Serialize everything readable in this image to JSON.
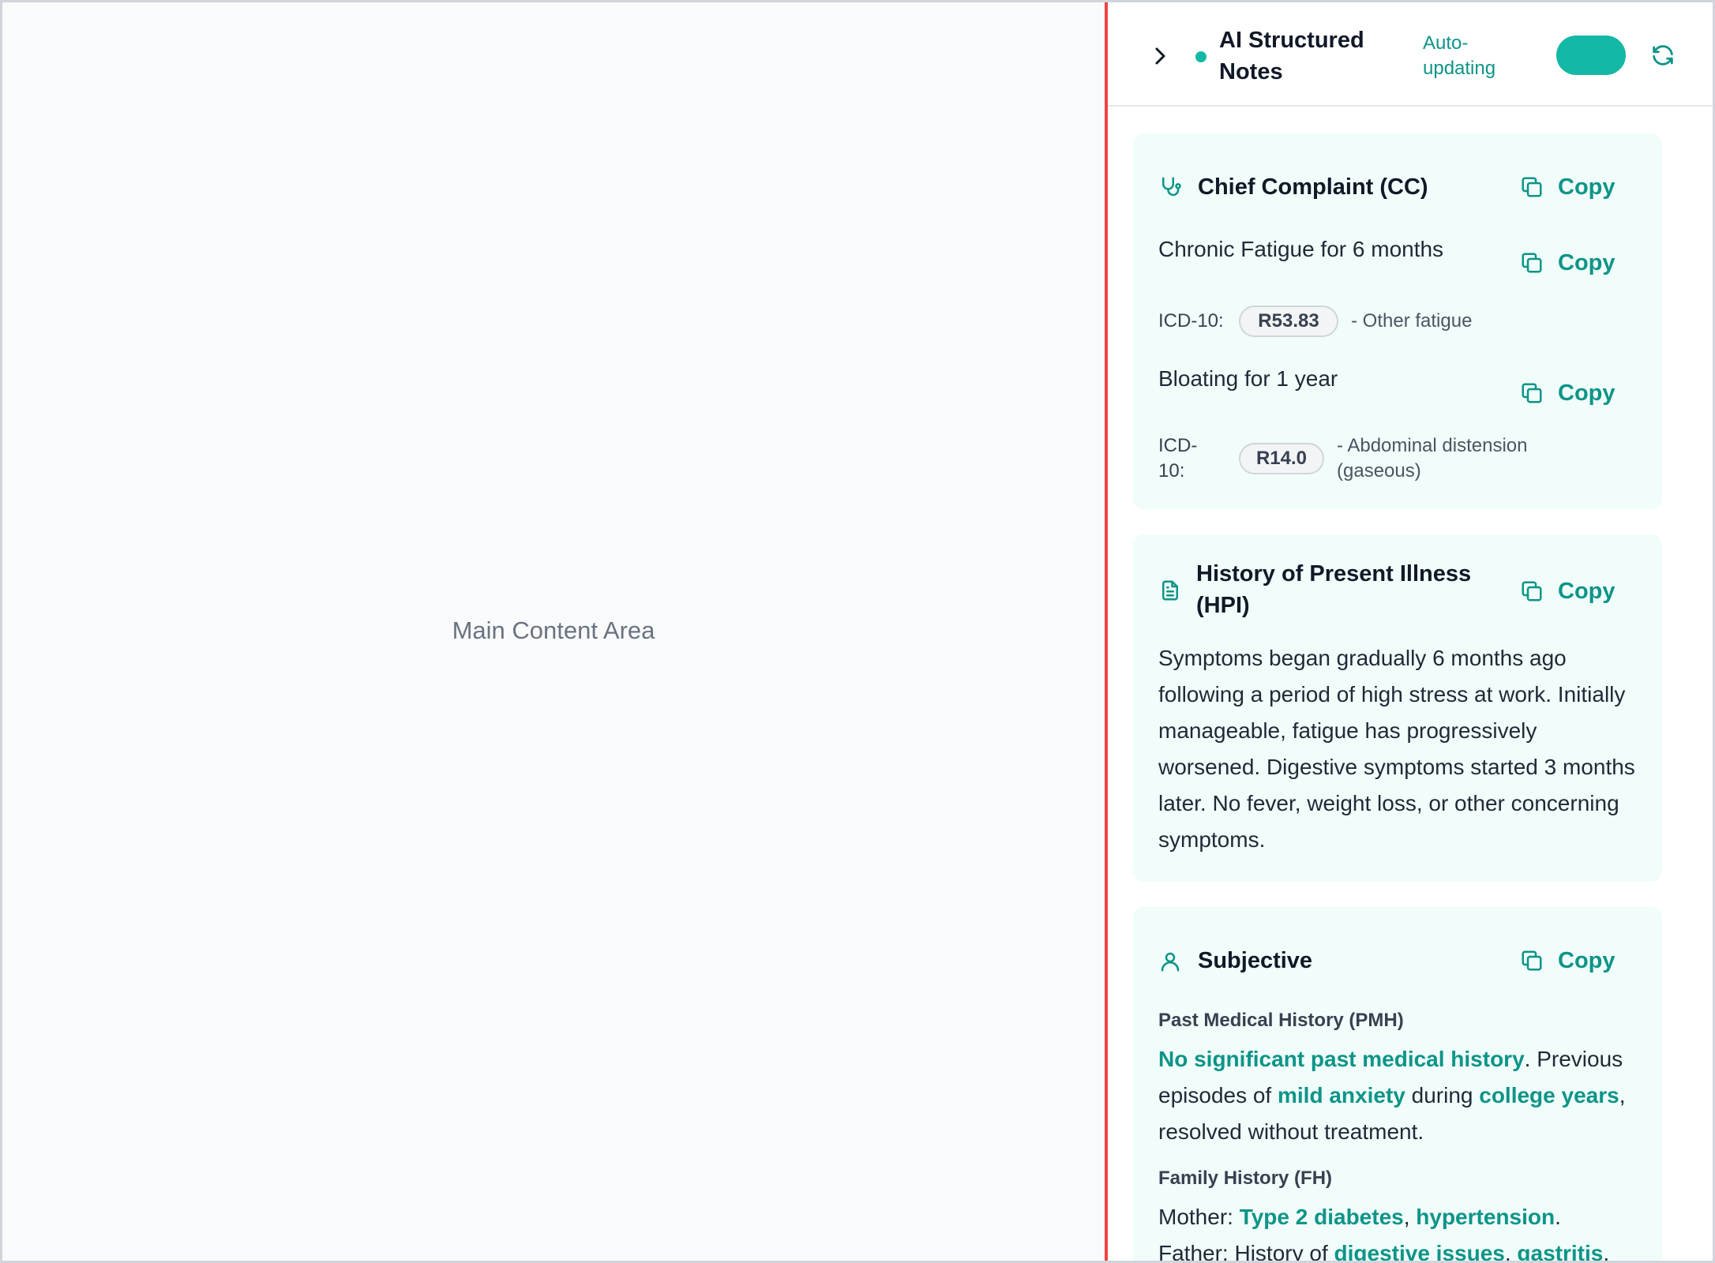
{
  "main": {
    "placeholder": "Main Content Area"
  },
  "panel": {
    "title": "AI Structured Notes",
    "status_label": "Auto-updating",
    "auto_update_enabled": true,
    "accent_color": "#14b8a6",
    "icons": {
      "collapse": "chevron-right-icon",
      "status": "status-dot-icon",
      "refresh": "refresh-icon",
      "copy": "copy-icon"
    }
  },
  "chief_complaint": {
    "title": "Chief Complaint (CC)",
    "icon": "stethoscope-icon",
    "copy_label": "Copy",
    "complaints": [
      {
        "text": "Chronic Fatigue for 6 months",
        "copy_label": "Copy",
        "icd_label": "ICD-10:",
        "icd_code": "R53.83",
        "icd_description": "- Other fatigue"
      },
      {
        "text": "Bloating for 1 year",
        "copy_label": "Copy",
        "icd_label": "ICD-10:",
        "icd_code": "R14.0",
        "icd_description": "- Abdominal distension (gaseous)"
      }
    ]
  },
  "hpi": {
    "title": "History of Present Illness (HPI)",
    "icon": "document-icon",
    "copy_label": "Copy",
    "text": "Symptoms began gradually 6 months ago following a period of high stress at work. Initially manageable, fatigue has progressively worsened. Digestive symptoms started 3 months later. No fever, weight loss, or other concerning symptoms."
  },
  "subjective": {
    "title": "Subjective",
    "icon": "user-icon",
    "copy_label": "Copy",
    "pmh": {
      "heading": "Past Medical History (PMH)",
      "hl1": "No significant past medical history",
      "t1": ". Previous episodes of ",
      "hl2": "mild anxiety",
      "t2": " during ",
      "hl3": "college years",
      "t3": ", resolved without treatment."
    },
    "fh": {
      "heading": "Family History (FH)",
      "mother_label": "Mother: ",
      "mother_hl1": "Type 2 diabetes",
      "mother_sep": ", ",
      "mother_hl2": "hypertension",
      "mother_end": ".",
      "father_label": "Father: History of ",
      "father_hl1": "digestive issues",
      "father_sep": ", ",
      "father_hl2": "gastritis",
      "father_end": "."
    }
  }
}
